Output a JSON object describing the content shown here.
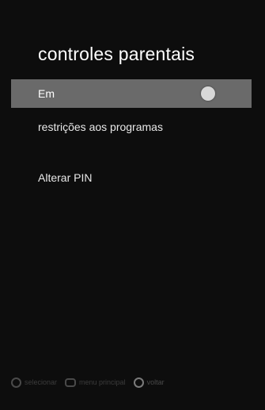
{
  "screen": {
    "title": "controles parentais"
  },
  "menu": {
    "items": [
      {
        "label": "Em",
        "selected": true,
        "toggle": "on"
      },
      {
        "label": "restrições aos programas"
      },
      {
        "label": "Alterar PIN"
      }
    ]
  },
  "footer": {
    "hints": [
      {
        "icon": "select-icon",
        "label": "selecionar"
      },
      {
        "icon": "menu-icon",
        "label": "menu principal"
      },
      {
        "icon": "back-icon",
        "label": "voltar"
      }
    ]
  },
  "colors": {
    "background": "#0d0d0d",
    "selected_row": "#6a6a6a",
    "text": "#e8e8e8",
    "toggle_knob": "#d8d8d8"
  }
}
